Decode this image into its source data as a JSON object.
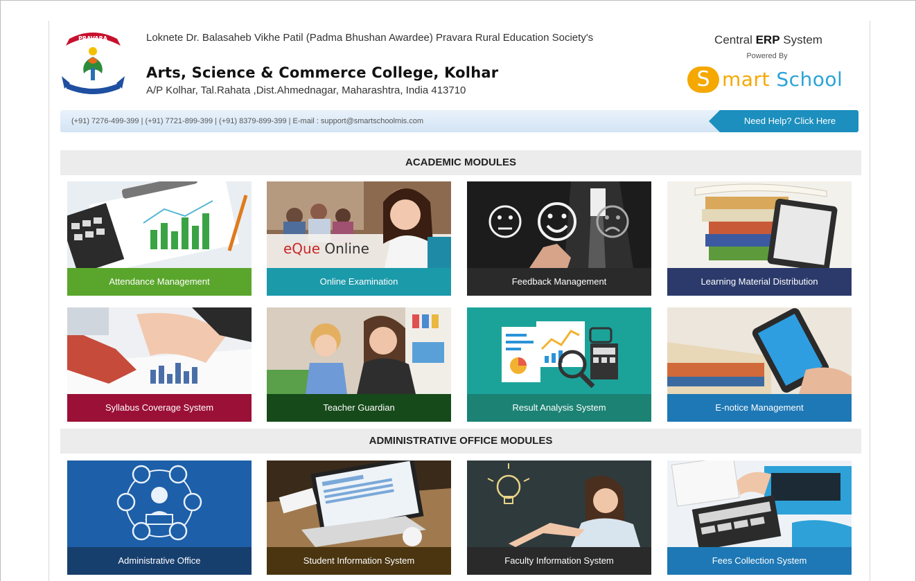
{
  "header": {
    "society": "Loknete Dr. Balasaheb Vikhe Patil (Padma Bhushan Awardee) Pravara Rural Education Society's",
    "college": "Arts, Science & Commerce College, Kolhar",
    "address": "A/P Kolhar, Tal.Rahata ,Dist.Ahmednagar, Maharashtra, India 413710",
    "logo_banner": "PRAVARA",
    "erp_prefix": "Central ",
    "erp_bold": "ERP",
    "erp_suffix": " System",
    "powered_by": "Powered By",
    "brand_s": "S",
    "brand_mart": "mart ",
    "brand_school": "School"
  },
  "contact": {
    "text": "(+91) 7276-499-399 | (+91) 7721-899-399 | (+91) 8379-899-399 | E-mail : support@smartschoolmis.com",
    "help_label": "Need Help? Click Here"
  },
  "sections": {
    "academic": "ACADEMIC MODULES",
    "administrative": "ADMINISTRATIVE OFFICE MODULES"
  },
  "academic_modules": [
    {
      "label": "Attendance Management",
      "color": "#5aa62c"
    },
    {
      "label": "Online Examination",
      "color": "#1b9aaa",
      "overlay_a": "eQue",
      "overlay_b": " Online"
    },
    {
      "label": "Feedback Management",
      "color": "#2a2a2a"
    },
    {
      "label": "Learning Material Distribution",
      "color": "#2b3a6b"
    },
    {
      "label": "Syllabus Coverage System",
      "color": "#9b1037"
    },
    {
      "label": "Teacher Guardian",
      "color": "#164a1a"
    },
    {
      "label": "Result Analysis System",
      "color": "#1b8274"
    },
    {
      "label": "E-notice Management",
      "color": "#1e78b5"
    }
  ],
  "admin_modules": [
    {
      "label": "Administrative Office",
      "color": "#173f6e"
    },
    {
      "label": "Student Information System",
      "color": "#4a3510"
    },
    {
      "label": "Faculty Information System",
      "color": "#2a2a2a"
    },
    {
      "label": "Fees Collection System",
      "color": "#1e78b5"
    }
  ]
}
